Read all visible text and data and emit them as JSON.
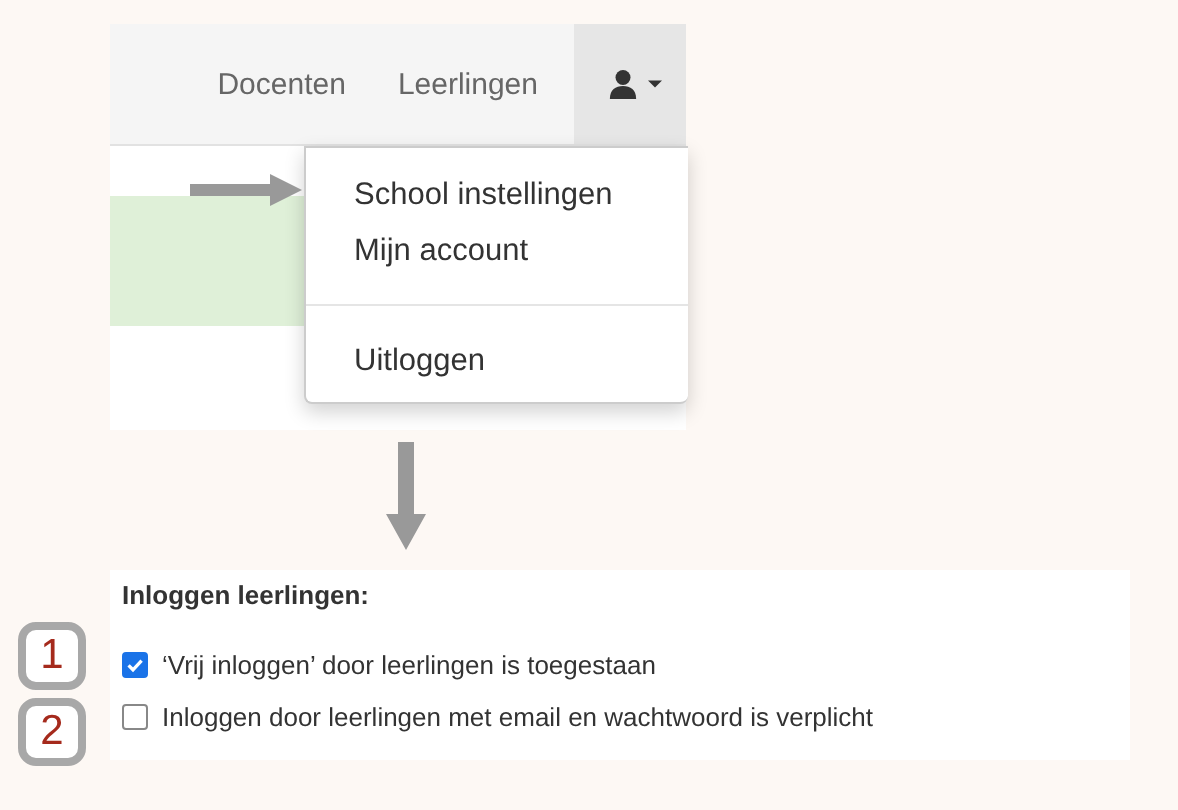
{
  "navbar": {
    "items": [
      {
        "label": "Docenten"
      },
      {
        "label": "Leerlingen"
      }
    ]
  },
  "user_menu": {
    "expanded": true,
    "items": [
      {
        "kind": "item",
        "label": "School instellingen"
      },
      {
        "kind": "item",
        "label": "Mijn account"
      },
      {
        "kind": "divider"
      },
      {
        "kind": "item",
        "label": "Uitloggen"
      }
    ]
  },
  "settings": {
    "heading": "Inloggen leerlingen:",
    "options": [
      {
        "badge": "1",
        "label": "‘Vrij inloggen’ door leerlingen is toegestaan",
        "checked": true
      },
      {
        "badge": "2",
        "label": "Inloggen door leerlingen met email en wachtwoord is verplicht",
        "checked": false
      }
    ]
  }
}
